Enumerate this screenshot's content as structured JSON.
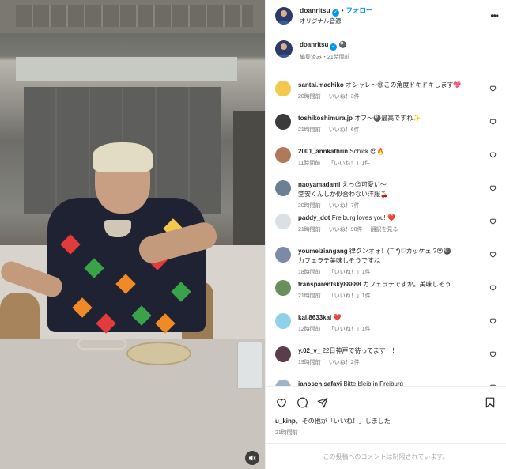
{
  "header": {
    "username": "doanritsu",
    "follow_label": "フォロー",
    "subtitle": "オリジナル音源",
    "more_label": "•••"
  },
  "caption": {
    "username": "doanritsu",
    "meta": "編集済み・21時間前"
  },
  "comments": [
    {
      "user": "santai.machiko",
      "text": "オシャレ〜😍この角度ドキドキします💖",
      "time": "20時間前",
      "likes": "いいね！3件",
      "reply": "",
      "avatar_color": "#f2c94c"
    },
    {
      "user": "toshikoshimura.jp",
      "text": "オフ〜🎱最高ですね✨",
      "time": "21時間前",
      "likes": "いいね！6件",
      "reply": "",
      "avatar_color": "#3b3b3b"
    },
    {
      "user": "2001_annkathrin",
      "text": "Schick 😍🔥",
      "time": "11時間前",
      "likes": "「いいね！」1件",
      "reply": "",
      "avatar_color": "#b07a5a"
    },
    {
      "user": "naoyamadami",
      "text": "えっ😍可愛い〜\n堂安くんしか似合わない洋服🍒",
      "time": "20時間前",
      "likes": "いいね！7件",
      "reply": "",
      "avatar_color": "#6d7f95"
    },
    {
      "user": "paddy_dot",
      "text": "Freiburg loves you! ❤️",
      "time": "21時間前",
      "likes": "いいね！90件",
      "reply": "翻訳を見る",
      "avatar_color": "#d9e0e6"
    },
    {
      "user": "youmeiziangang",
      "text": "律クンオォ！(ˊ˘ˋ*)♡カッケェ!?😍🎱\nカフェラテ美味しそうですね",
      "time": "18時間前",
      "likes": "「いいね！」1件",
      "reply": "",
      "avatar_color": "#7d8aa6"
    },
    {
      "user": "transparentsky88888",
      "text": "カフェラテですか。美味しそう",
      "time": "21時間前",
      "likes": "「いいね！」1件",
      "reply": "",
      "avatar_color": "#6a8f5b"
    },
    {
      "user": "kai.8633kai",
      "text": "❤️",
      "time": "12時間前",
      "likes": "「いいね！」1件",
      "reply": "",
      "avatar_color": "#8ed1e8"
    },
    {
      "user": "y.02_v_",
      "text": "22日神戸で待ってます！！",
      "time": "19時間前",
      "likes": "いいね！2件",
      "reply": "",
      "avatar_color": "#5a3d4b"
    },
    {
      "user": "janosch.safavi",
      "text": "Bitte bleib in Freiburg",
      "time": "",
      "likes": "",
      "reply": "",
      "avatar_color": "#9fb4c7"
    }
  ],
  "actions": {
    "liked_by_user": "u_kinp",
    "liked_by_text": "、その他が「いいね！」しました",
    "time": "21時間前",
    "comments_disabled": "この投稿へのコメントは制限されています。"
  },
  "icons": {
    "heart": "heart-icon",
    "comment": "comment-icon",
    "share": "share-icon",
    "save": "bookmark-icon",
    "mute": "speaker-muted-icon",
    "more": "more-icon"
  },
  "colors": {
    "accent": "#0095f6",
    "muted_text": "#737373",
    "disabled_text": "#a8a8a8"
  }
}
